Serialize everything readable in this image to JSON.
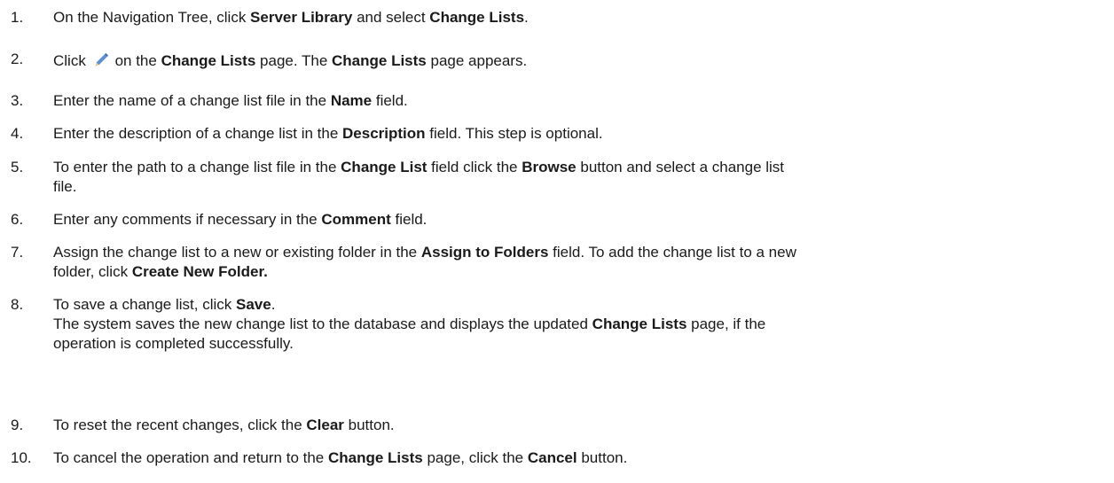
{
  "steps": [
    {
      "num": "1.",
      "parts": [
        "On the Navigation Tree, click ",
        "Server Library",
        " and select ",
        "Change Lists",
        "."
      ]
    },
    {
      "num": "2.",
      "parts": [
        "Click ",
        "on the ",
        "Change Lists",
        " page. The ",
        "Change Lists",
        " page appears."
      ],
      "icon": "edit-pencil-icon"
    },
    {
      "num": "3.",
      "parts": [
        "Enter the name of a change list file in the ",
        "Name",
        " field."
      ]
    },
    {
      "num": "4.",
      "parts": [
        "Enter the description of a change list in the ",
        "Description",
        " field. This step is optional."
      ]
    },
    {
      "num": "5.",
      "parts": [
        "To enter the path to a change list file in the ",
        "Change List",
        " field click the ",
        "Browse",
        " button and select a change list",
        "file."
      ]
    },
    {
      "num": "6.",
      "parts": [
        "Enter any comments if necessary in the ",
        "Comment",
        " field."
      ]
    },
    {
      "num": "7.",
      "parts": [
        "Assign the change list to a new or existing folder in the ",
        "Assign to Folders",
        " field. To add the change list to a new",
        "folder, click ",
        "Create New Folder."
      ]
    },
    {
      "num": "8.",
      "parts": [
        "To save a change list, click ",
        "Save",
        ".",
        "The system saves the new change list to the database and displays the updated ",
        "Change Lists",
        " page, if the",
        "operation is completed successfully."
      ]
    },
    {
      "num": "9.",
      "parts": [
        "To reset the recent changes, click the ",
        "Clear",
        " button."
      ]
    },
    {
      "num": "10.",
      "parts": [
        "To cancel the operation and return to the ",
        "Change Lists",
        " page, click the ",
        "Cancel",
        " button."
      ]
    }
  ],
  "colors": {
    "text": "#1a1a1a",
    "icon_fill": "#5b8fd6",
    "icon_tip": "#f2c98a"
  }
}
